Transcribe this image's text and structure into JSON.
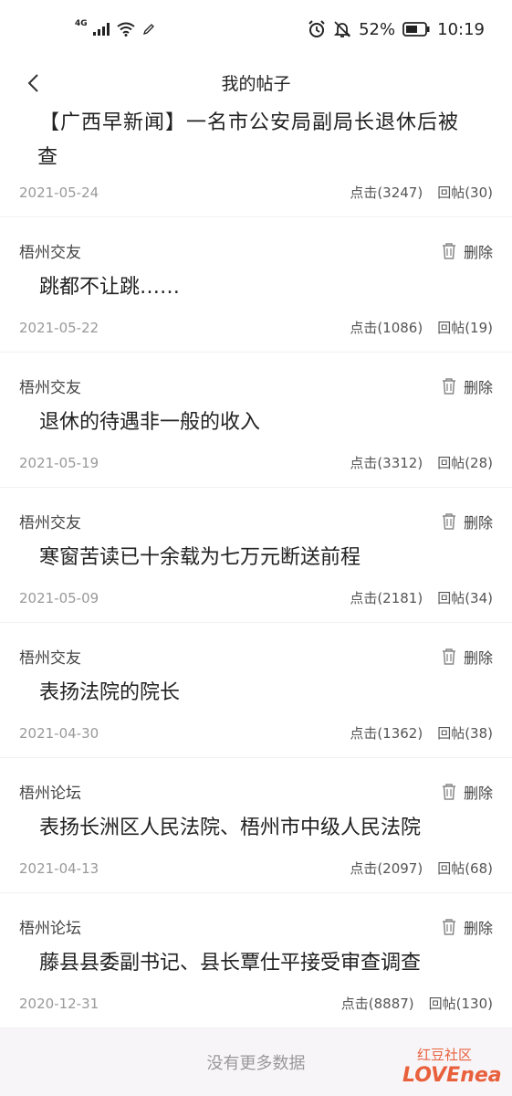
{
  "statusbar": {
    "network": "4G",
    "battery_percent": "52%",
    "time": "10:19"
  },
  "header": {
    "title": "我的帖子"
  },
  "posts": [
    {
      "forum": "",
      "title": "【广西早新闻】一名市公安局副局长退休后被查",
      "title_line1": "【广西早新闻】一名市公安局副局长退休后被",
      "title_line2": "查",
      "date": "2021-05-24",
      "clicks": "点击(3247)",
      "replies": "回帖(30)"
    },
    {
      "forum": "梧州交友",
      "delete_label": "删除",
      "title": "跳都不让跳……",
      "date": "2021-05-22",
      "clicks": "点击(1086)",
      "replies": "回帖(19)"
    },
    {
      "forum": "梧州交友",
      "delete_label": "删除",
      "title": "退休的待遇非一般的收入",
      "date": "2021-05-19",
      "clicks": "点击(3312)",
      "replies": "回帖(28)"
    },
    {
      "forum": "梧州交友",
      "delete_label": "删除",
      "title": "寒窗苦读已十余载为七万元断送前程",
      "date": "2021-05-09",
      "clicks": "点击(2181)",
      "replies": "回帖(34)"
    },
    {
      "forum": "梧州交友",
      "delete_label": "删除",
      "title": "表扬法院的院长",
      "date": "2021-04-30",
      "clicks": "点击(1362)",
      "replies": "回帖(38)"
    },
    {
      "forum": "梧州论坛",
      "delete_label": "删除",
      "title": "表扬长洲区人民法院、梧州市中级人民法院",
      "date": "2021-04-13",
      "clicks": "点击(2097)",
      "replies": "回帖(68)"
    },
    {
      "forum": "梧州论坛",
      "delete_label": "删除",
      "title": "藤县县委副书记、县长覃仕平接受审查调查",
      "date": "2020-12-31",
      "clicks": "点击(8887)",
      "replies": "回帖(130)"
    }
  ],
  "footer": {
    "no_more": "没有更多数据"
  },
  "watermark": {
    "line1": "红豆社区",
    "line2": "LOVEnea"
  },
  "colors": {
    "watermark": "#e8603c"
  }
}
